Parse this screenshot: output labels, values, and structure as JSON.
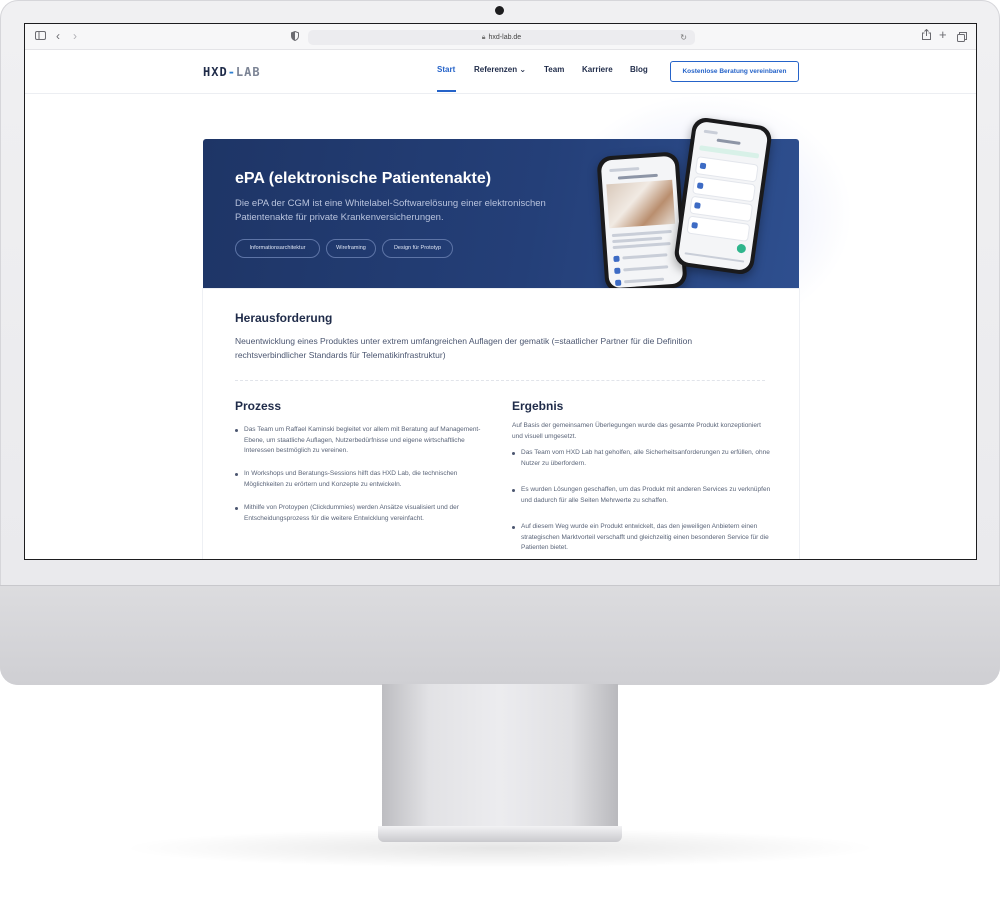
{
  "browser": {
    "url": "hxd-lab.de"
  },
  "nav": {
    "logo_prefix": "HXD",
    "logo_dash": "-",
    "logo_suffix": "LAB",
    "items": [
      {
        "label": "Start",
        "active": true
      },
      {
        "label": "Referenzen ⌄",
        "active": false
      },
      {
        "label": "Team",
        "active": false
      },
      {
        "label": "Karriere",
        "active": false
      },
      {
        "label": "Blog",
        "active": false
      }
    ],
    "cta": "Kostenlose Beratung vereinbaren"
  },
  "hero": {
    "title": "ePA (elektronische Patientenakte)",
    "subtitle": "Die ePA der CGM ist eine Whitelabel-Softwarelösung einer elektronischen Patientenakte für private Krankenversicherungen.",
    "tags": [
      "Informationsarchitektur",
      "Wireframing",
      "Design für Prototyp"
    ]
  },
  "challenge": {
    "title": "Herausforderung",
    "text": "Neuentwicklung eines Produktes unter extrem umfangreichen Auflagen der gematik (=staatlicher Partner für die Definition rechtsverbindlicher Standards für Telematikinfrastruktur)"
  },
  "process": {
    "title": "Prozess",
    "bullets": [
      "Das Team um Raffael Kaminski begleitet vor allem mit Beratung auf Management-Ebene, um staatliche Auflagen, Nutzerbedürfnisse und eigene wirtschaftliche Interessen bestmöglich zu vereinen.",
      "In Workshops und Beratungs-Sessions hilft das HXD Lab, die technischen Möglichkeiten zu erörtern und Konzepte zu entwickeln.",
      "Mithilfe von Protoypen (Clickdummies) werden Ansätze visualisiert und der Entscheidungsprozess für die weitere Entwicklung vereinfacht."
    ]
  },
  "result": {
    "title": "Ergebnis",
    "intro": "Auf Basis der gemeinsamen Überlegungen wurde das gesamte Produkt konzeptioniert und visuell umgesetzt.",
    "bullets": [
      "Das Team vom HXD Lab hat geholfen, alle Sicherheitsanforderungen zu erfüllen, ohne Nutzer zu überfordern.",
      "Es wurden Lösungen geschaffen, um das Produkt mit anderen Services zu verknüpfen und dadurch für alle Seiten Mehrwerte zu schaffen.",
      "Auf diesem Weg wurde ein Produkt entwickelt, das den jeweiligen Anbietern einen strategischen Marktvorteil verschafft und gleichzeitig einen besonderen Service für die Patienten bietet."
    ]
  },
  "colors": {
    "brand_navy": "#1f2b49",
    "accent_blue": "#2563c9",
    "hero_bg": "#243f78",
    "fab_green": "#2fb58c"
  },
  "icons": [
    "sidebar-icon",
    "back-icon",
    "forward-icon",
    "shield-icon",
    "lock-icon",
    "reload-icon",
    "share-icon",
    "plus-icon",
    "tabs-icon"
  ]
}
